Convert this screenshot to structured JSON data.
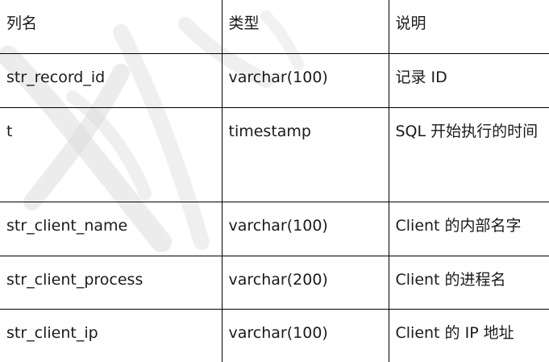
{
  "table": {
    "headers": [
      "列名",
      "类型",
      "说明"
    ],
    "rows": [
      {
        "name": "str_record_id",
        "type": "varchar(100)",
        "desc": "记录 ID"
      },
      {
        "name": "t",
        "type": "timestamp",
        "desc": "SQL 开始执行的时间"
      },
      {
        "name": "str_client_name",
        "type": "varchar(100)",
        "desc": "Client 的内部名字"
      },
      {
        "name": "str_client_process",
        "type": "varchar(200)",
        "desc": "Client 的进程名"
      },
      {
        "name": "str_client_ip",
        "type": "varchar(100)",
        "desc": "Client 的 IP 地址"
      }
    ]
  },
  "colors": {
    "border": "#000000",
    "text": "#1a1a1a",
    "watermark": "#d8d8d8"
  }
}
